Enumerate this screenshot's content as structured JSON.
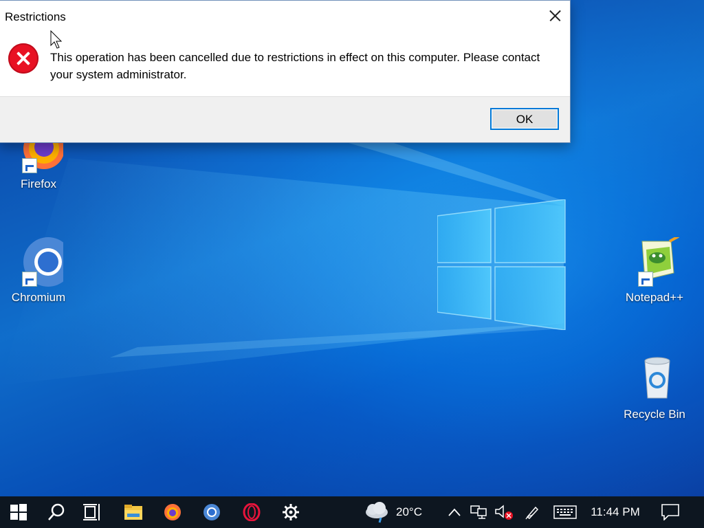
{
  "dialog": {
    "title": "Restrictions",
    "message": "This operation has been cancelled due to restrictions in effect on this computer. Please contact your system administrator.",
    "ok_label": "OK",
    "close_icon": "close-icon",
    "status_icon": "error-icon"
  },
  "desktop_icons": [
    {
      "label": "Firefox",
      "icon": "firefox-icon",
      "shortcut": true
    },
    {
      "label": "Chromium",
      "icon": "chromium-icon",
      "shortcut": true
    },
    {
      "label": "Notepad++",
      "icon": "notepad-plus-plus-icon",
      "shortcut": true
    },
    {
      "label": "Recycle Bin",
      "icon": "recycle-bin-icon",
      "shortcut": false
    }
  ],
  "taskbar": {
    "pinned": [
      "start-icon",
      "search-icon",
      "task-view-icon",
      "file-explorer-icon",
      "firefox-icon",
      "chromium-icon",
      "opera-icon",
      "settings-icon"
    ],
    "weather": {
      "temperature": "20°C",
      "icon": "cloudy-rain-icon"
    },
    "tray_icons": [
      "chevron-up-icon",
      "network-icon",
      "volume-muted-icon",
      "pen-icon",
      "keyboard-icon"
    ],
    "clock": "11:44 PM",
    "notifications_icon": "action-center-icon"
  },
  "colors": {
    "accent": "#0078d7",
    "error": "#e81123",
    "taskbar": "#0d1620",
    "wallpaper": "#0a67cf"
  }
}
